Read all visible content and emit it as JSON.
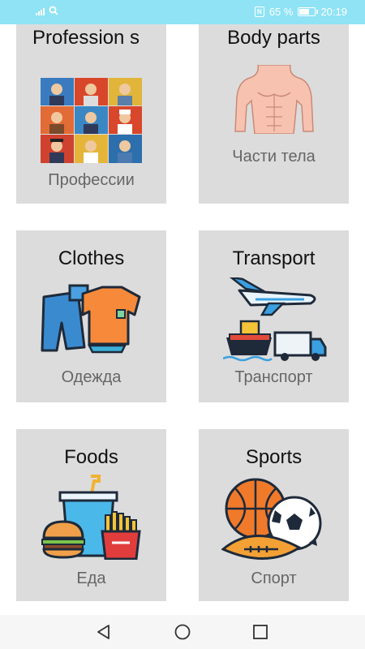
{
  "status": {
    "battery": "65 %",
    "time": "20:19"
  },
  "categories": [
    {
      "title": "Profession s",
      "subtitle": "Профессии"
    },
    {
      "title": "Body parts",
      "subtitle": "Части тела"
    },
    {
      "title": "Clothes",
      "subtitle": "Одежда"
    },
    {
      "title": "Transport",
      "subtitle": "Транспорт"
    },
    {
      "title": "Foods",
      "subtitle": "Еда"
    },
    {
      "title": "Sports",
      "subtitle": "Спорт"
    }
  ],
  "nav": {
    "back_icon": "back-triangle-icon",
    "home_icon": "home-circle-icon",
    "recents_icon": "recents-square-icon"
  }
}
